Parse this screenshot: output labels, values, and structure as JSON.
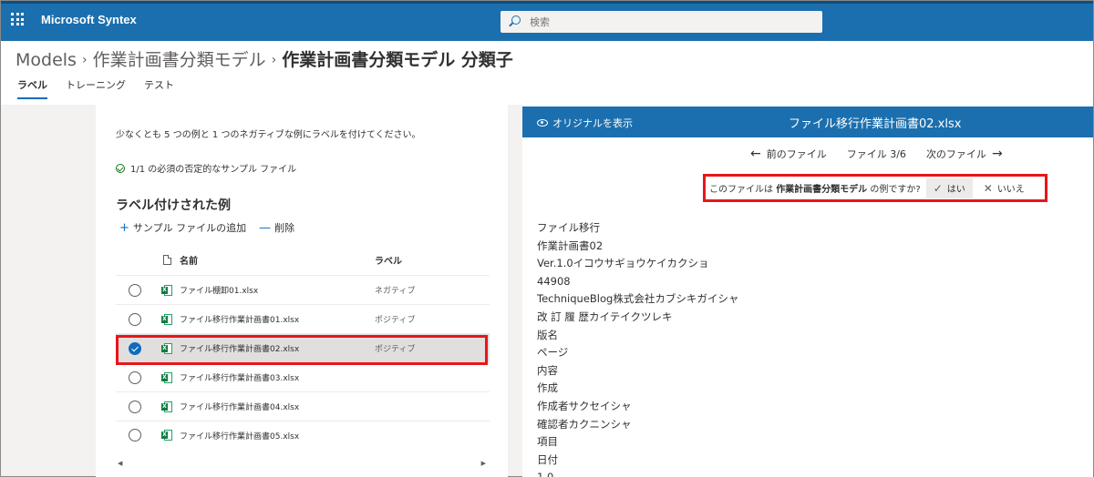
{
  "suitebar": {
    "app_name": "Microsoft Syntex",
    "search_placeholder": "検索"
  },
  "breadcrumb": {
    "items": [
      "Models",
      "作業計画書分類モデル"
    ],
    "separator": "›",
    "current": "作業計画書分類モデル 分類子"
  },
  "tabs": [
    {
      "label": "ラベル",
      "active": true
    },
    {
      "label": "トレーニング",
      "active": false
    },
    {
      "label": "テスト",
      "active": false
    }
  ],
  "left": {
    "instruction": "少なくとも 5 つの例と 1 つのネガティブな例にラベルを付けてください。",
    "requirement": "1/1 の必須の否定的なサンプル ファイル",
    "section_title": "ラベル付けされた例",
    "add_label": "サンプル ファイルの追加",
    "delete_label": "削除",
    "columns": {
      "name": "名前",
      "label": "ラベル"
    },
    "rows": [
      {
        "name": "ファイル棚卸01.xlsx",
        "label": "ネガティブ",
        "selected": false
      },
      {
        "name": "ファイル移行作業計画書01.xlsx",
        "label": "ポジティブ",
        "selected": false
      },
      {
        "name": "ファイル移行作業計画書02.xlsx",
        "label": "ポジティブ",
        "selected": true
      },
      {
        "name": "ファイル移行作業計画書03.xlsx",
        "label": "",
        "selected": false
      },
      {
        "name": "ファイル移行作業計画書04.xlsx",
        "label": "",
        "selected": false
      },
      {
        "name": "ファイル移行作業計画書05.xlsx",
        "label": "",
        "selected": false
      }
    ],
    "excel_glyph": "X"
  },
  "right": {
    "show_original": "オリジナルを表示",
    "file_title": "ファイル移行作業計画書02.xlsx",
    "prev_file": "前のファイル",
    "file_counter": "ファイル 3/6",
    "next_file": "次のファイル",
    "question_prefix": "このファイルは",
    "question_model": "作業計画書分類モデル",
    "question_suffix": "の例ですか?",
    "yes": "はい",
    "no": "いいえ",
    "content_lines": [
      "ファイル移行",
      "作業計画書02",
      "Ver.1.0イコウサギョウケイカクショ",
      "44908",
      "TechniqueBlog株式会社カブシキガイシャ",
      "改 訂 履 歴カイテイクツレキ",
      "版名",
      "ページ",
      "内容",
      "作成",
      "作成者サクセイシャ",
      "確認者カクニンシャ",
      "項目",
      "日付",
      "1.0"
    ]
  },
  "colors": {
    "suitebar": "#1b6fae",
    "accent": "#0f6cbd",
    "highlight_border": "#e8151b",
    "excel_green": "#107c41"
  }
}
